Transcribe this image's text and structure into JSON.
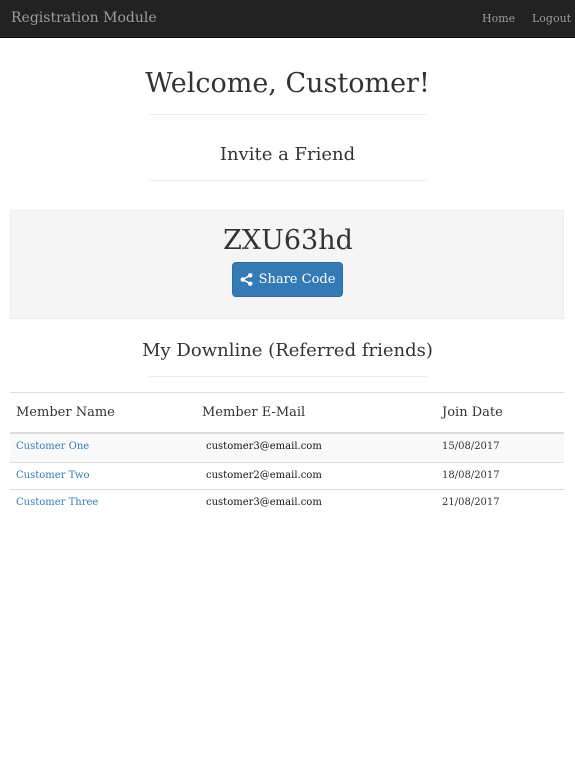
{
  "navbar": {
    "brand": "Registration Module",
    "links": [
      {
        "label": "Home"
      },
      {
        "label": "Logout"
      }
    ]
  },
  "main": {
    "welcome": "Welcome, Customer!",
    "invite_heading": "Invite a Friend",
    "referral_code": "ZXU63hd",
    "share_button_label": "Share Code",
    "share_icon": "share-alt-icon",
    "downline_heading": "My Downline (Referred friends)"
  },
  "table": {
    "headers": [
      "Member Name",
      "Member E-Mail",
      "Join Date"
    ],
    "rows": [
      {
        "name": "Customer One",
        "email": "customer3@email.com",
        "date": "15/08/2017"
      },
      {
        "name": "Customer Two",
        "email": "customer2@email.com",
        "date": "18/08/2017"
      },
      {
        "name": "Customer Three",
        "email": "customer3@email.com",
        "date": "21/08/2017"
      }
    ]
  },
  "colors": {
    "navbar_bg": "#222222",
    "primary": "#337ab7",
    "link": "#337ab7",
    "well_bg": "#f5f5f5"
  }
}
